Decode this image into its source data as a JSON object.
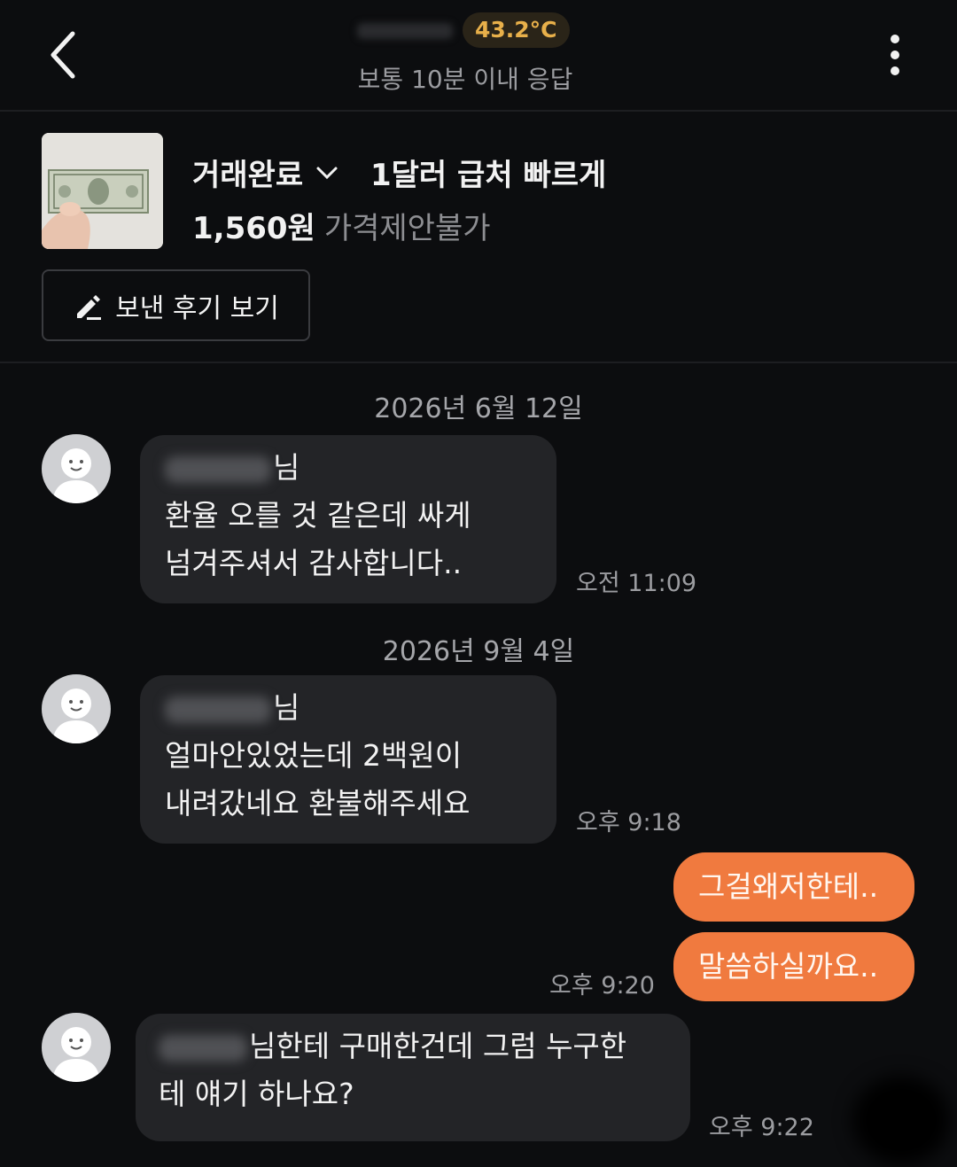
{
  "header": {
    "temperature": "43.2°C",
    "response_time": "보통 10분 이내 응답"
  },
  "product": {
    "status": "거래완료",
    "title": "1달러 급처 빠르게",
    "price": "1,560원",
    "price_note": "가격제안불가",
    "review_button": "보낸 후기 보기"
  },
  "chat": {
    "date1": "2026년 6월 12일",
    "msg1": {
      "sender_suffix": "님",
      "line1": "환율 오를 것 같은데 싸게",
      "line2": "넘겨주셔서 감사합니다..",
      "time": "오전 11:09"
    },
    "date2": "2026년 9월 4일",
    "msg2": {
      "sender_suffix": "님",
      "line1": "얼마안있었는데 2백원이",
      "line2": "내려갔네요 환불해주세요",
      "time": "오후 9:18"
    },
    "out1": "그걸왜저한테..",
    "out2": "말씀하실까요..",
    "out_time": "오후 9:20",
    "msg3": {
      "line1": "님한테 구매한건데 그럼 누구한",
      "line2": "테 얘기 하나요?",
      "time": "오후 9:22"
    }
  },
  "colors": {
    "background": "#0c0d0f",
    "accent": "#f07a3f",
    "temperature": "#e8b04a",
    "bubble_in": "#232427"
  }
}
